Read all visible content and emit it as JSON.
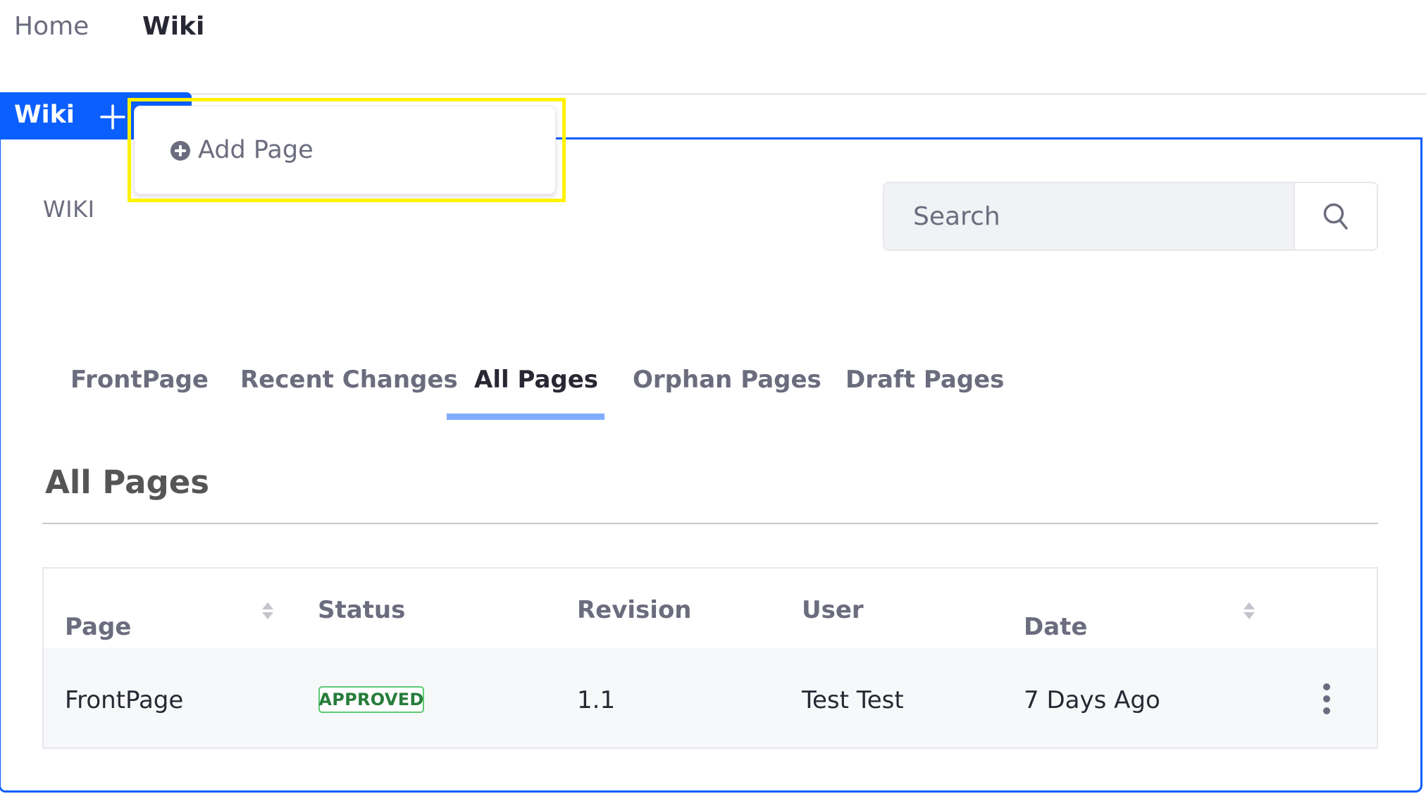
{
  "top_nav": {
    "items": [
      {
        "label": "Home",
        "active": false
      },
      {
        "label": "Wiki",
        "active": true
      }
    ]
  },
  "portlet_tab": {
    "label": "Wiki",
    "add_icon": "plus-icon"
  },
  "add_menu": {
    "items": [
      {
        "label": "Add Page",
        "icon": "plus-circle-icon"
      }
    ]
  },
  "section_label": "WIKI",
  "search": {
    "placeholder": "Search",
    "value": "",
    "button_icon": "search-icon"
  },
  "tabs": [
    {
      "label": "FrontPage",
      "active": false
    },
    {
      "label": "Recent Changes",
      "active": false
    },
    {
      "label": "All Pages",
      "active": true
    },
    {
      "label": "Orphan Pages",
      "active": false
    },
    {
      "label": "Draft Pages",
      "active": false
    }
  ],
  "heading": "All Pages",
  "table": {
    "columns": [
      {
        "label": "Page",
        "sortable": true
      },
      {
        "label": "Status",
        "sortable": false
      },
      {
        "label": "Revision",
        "sortable": false
      },
      {
        "label": "User",
        "sortable": false
      },
      {
        "label": "Date",
        "sortable": true
      }
    ],
    "rows": [
      {
        "page": "FrontPage",
        "status": "APPROVED",
        "revision": "1.1",
        "user": "Test Test",
        "date": "7 Days Ago",
        "actions_icon": "kebab-menu-icon"
      }
    ]
  },
  "colors": {
    "primary": "#0b5fff",
    "tab_indicator": "#80acff",
    "status_approved_border": "#5aca75",
    "status_approved_text": "#287d3c",
    "highlight": "#fff200"
  }
}
